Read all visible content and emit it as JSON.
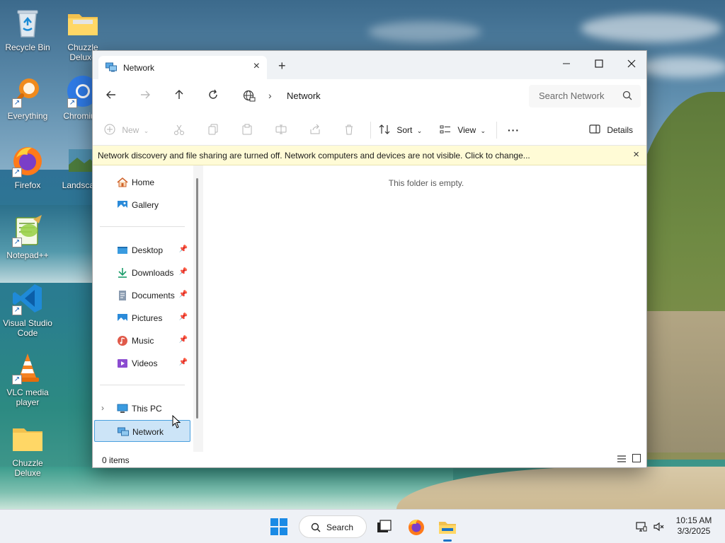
{
  "desktop": {
    "icons": [
      {
        "label": "Recycle Bin"
      },
      {
        "label": "Chuzzle Deluxe"
      },
      {
        "label": "Everything"
      },
      {
        "label": "Chromium"
      },
      {
        "label": "Firefox"
      },
      {
        "label": "Landscape"
      },
      {
        "label": "Notepad++"
      },
      {
        "label": "Visual Studio Code"
      },
      {
        "label": "VLC media player"
      },
      {
        "label": "Chuzzle Deluxe"
      }
    ]
  },
  "window": {
    "tab_title": "Network",
    "new_tab_glyph": "+",
    "address": "Network",
    "search_placeholder": "Search Network",
    "toolbar": {
      "new_label": "New",
      "sort_label": "Sort",
      "view_label": "View",
      "more_label": "···",
      "details_label": "Details"
    },
    "infobar_text": "Network discovery and file sharing are turned off. Network computers and devices are not visible. Click to change...",
    "nav_pane": {
      "items": [
        {
          "label": "Home",
          "icon": "home-icon"
        },
        {
          "label": "Gallery",
          "icon": "gallery-icon"
        },
        {
          "label": "Desktop",
          "icon": "desktop-icon",
          "pinned": true
        },
        {
          "label": "Downloads",
          "icon": "downloads-icon",
          "pinned": true
        },
        {
          "label": "Documents",
          "icon": "documents-icon",
          "pinned": true
        },
        {
          "label": "Pictures",
          "icon": "pictures-icon",
          "pinned": true
        },
        {
          "label": "Music",
          "icon": "music-icon",
          "pinned": true
        },
        {
          "label": "Videos",
          "icon": "videos-icon",
          "pinned": true
        },
        {
          "label": "This PC",
          "icon": "computer-icon"
        },
        {
          "label": "Network",
          "icon": "network-icon",
          "selected": true
        }
      ]
    },
    "empty_message": "This folder is empty.",
    "status": "0 items"
  },
  "taskbar": {
    "search_label": "Search",
    "time": "10:15 AM",
    "date": "3/3/2025"
  },
  "colors": {
    "selection": "#cce4f7",
    "selection_border": "#4aa0de",
    "infobar": "#fffbd6",
    "accent": "#1a73c8"
  }
}
